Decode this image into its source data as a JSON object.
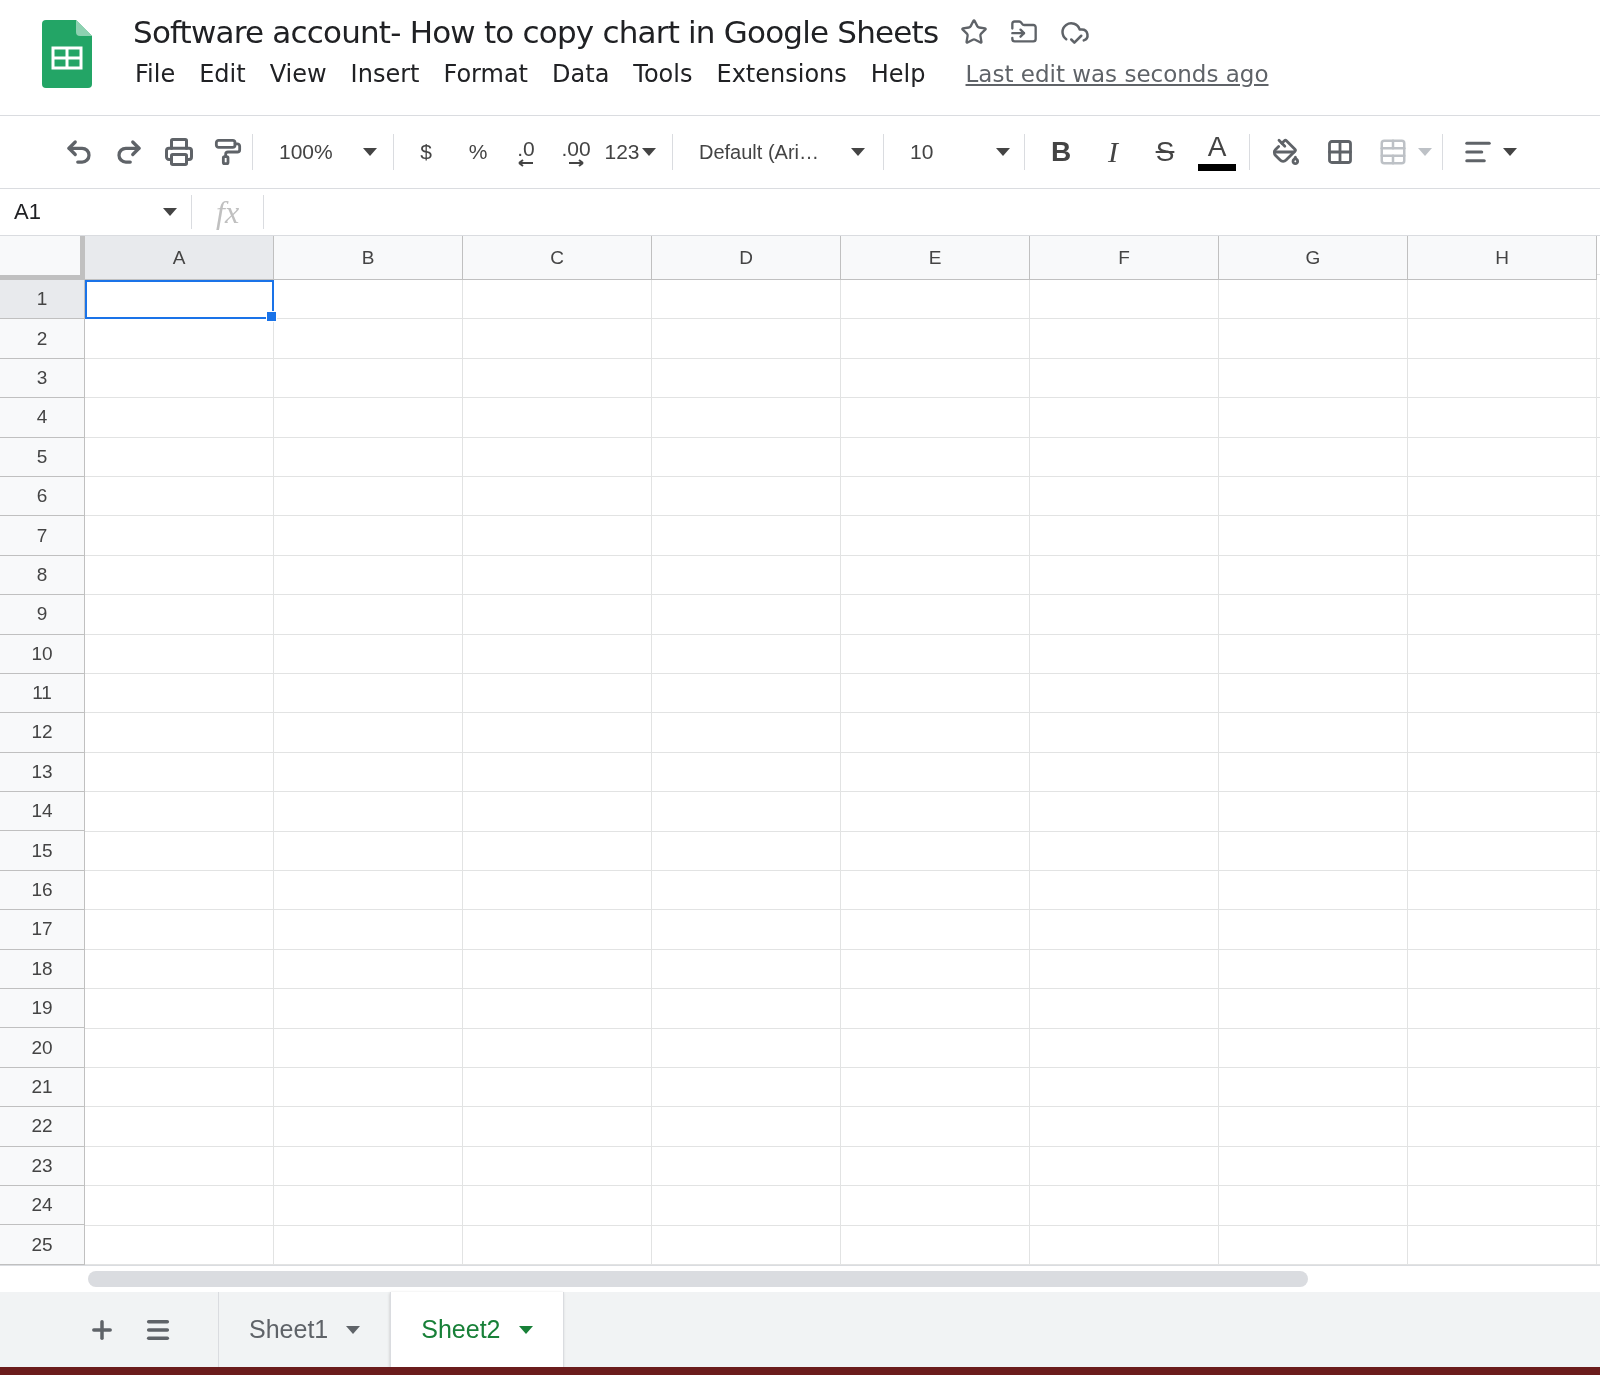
{
  "document": {
    "title": "Software account- How to copy chart in Google Sheets",
    "starred": false
  },
  "menu": [
    "File",
    "Edit",
    "View",
    "Insert",
    "Format",
    "Data",
    "Tools",
    "Extensions",
    "Help"
  ],
  "last_edit": "Last edit was seconds ago",
  "toolbar": {
    "zoom": "100%",
    "currency": "$",
    "percent": "%",
    "decrease_decimals": ".0",
    "increase_decimals": ".00",
    "number_format": "123",
    "font": "Default (Ari…",
    "font_size": "10",
    "bold": "B",
    "italic": "I",
    "strikethrough": "S",
    "text_color": "A"
  },
  "name_box": "A1",
  "formula_label": "fx",
  "columns": [
    {
      "label": "A",
      "selected": true
    },
    {
      "label": "B",
      "selected": false
    },
    {
      "label": "C",
      "selected": false
    },
    {
      "label": "D",
      "selected": false
    },
    {
      "label": "E",
      "selected": false
    },
    {
      "label": "F",
      "selected": false
    },
    {
      "label": "G",
      "selected": false
    },
    {
      "label": "H",
      "selected": false
    }
  ],
  "rows": [
    {
      "label": "1",
      "selected": true
    },
    {
      "label": "2",
      "selected": false
    },
    {
      "label": "3",
      "selected": false
    },
    {
      "label": "4",
      "selected": false
    },
    {
      "label": "5",
      "selected": false
    },
    {
      "label": "6",
      "selected": false
    },
    {
      "label": "7",
      "selected": false
    },
    {
      "label": "8",
      "selected": false
    },
    {
      "label": "9",
      "selected": false
    },
    {
      "label": "10",
      "selected": false
    },
    {
      "label": "11",
      "selected": false
    },
    {
      "label": "12",
      "selected": false
    },
    {
      "label": "13",
      "selected": false
    },
    {
      "label": "14",
      "selected": false
    },
    {
      "label": "15",
      "selected": false
    },
    {
      "label": "16",
      "selected": false
    },
    {
      "label": "17",
      "selected": false
    },
    {
      "label": "18",
      "selected": false
    },
    {
      "label": "19",
      "selected": false
    },
    {
      "label": "20",
      "selected": false
    },
    {
      "label": "21",
      "selected": false
    },
    {
      "label": "22",
      "selected": false
    },
    {
      "label": "23",
      "selected": false
    },
    {
      "label": "24",
      "selected": false
    },
    {
      "label": "25",
      "selected": false
    }
  ],
  "sheets": [
    {
      "name": "Sheet1",
      "selected": false
    },
    {
      "name": "Sheet2",
      "selected": true
    }
  ]
}
